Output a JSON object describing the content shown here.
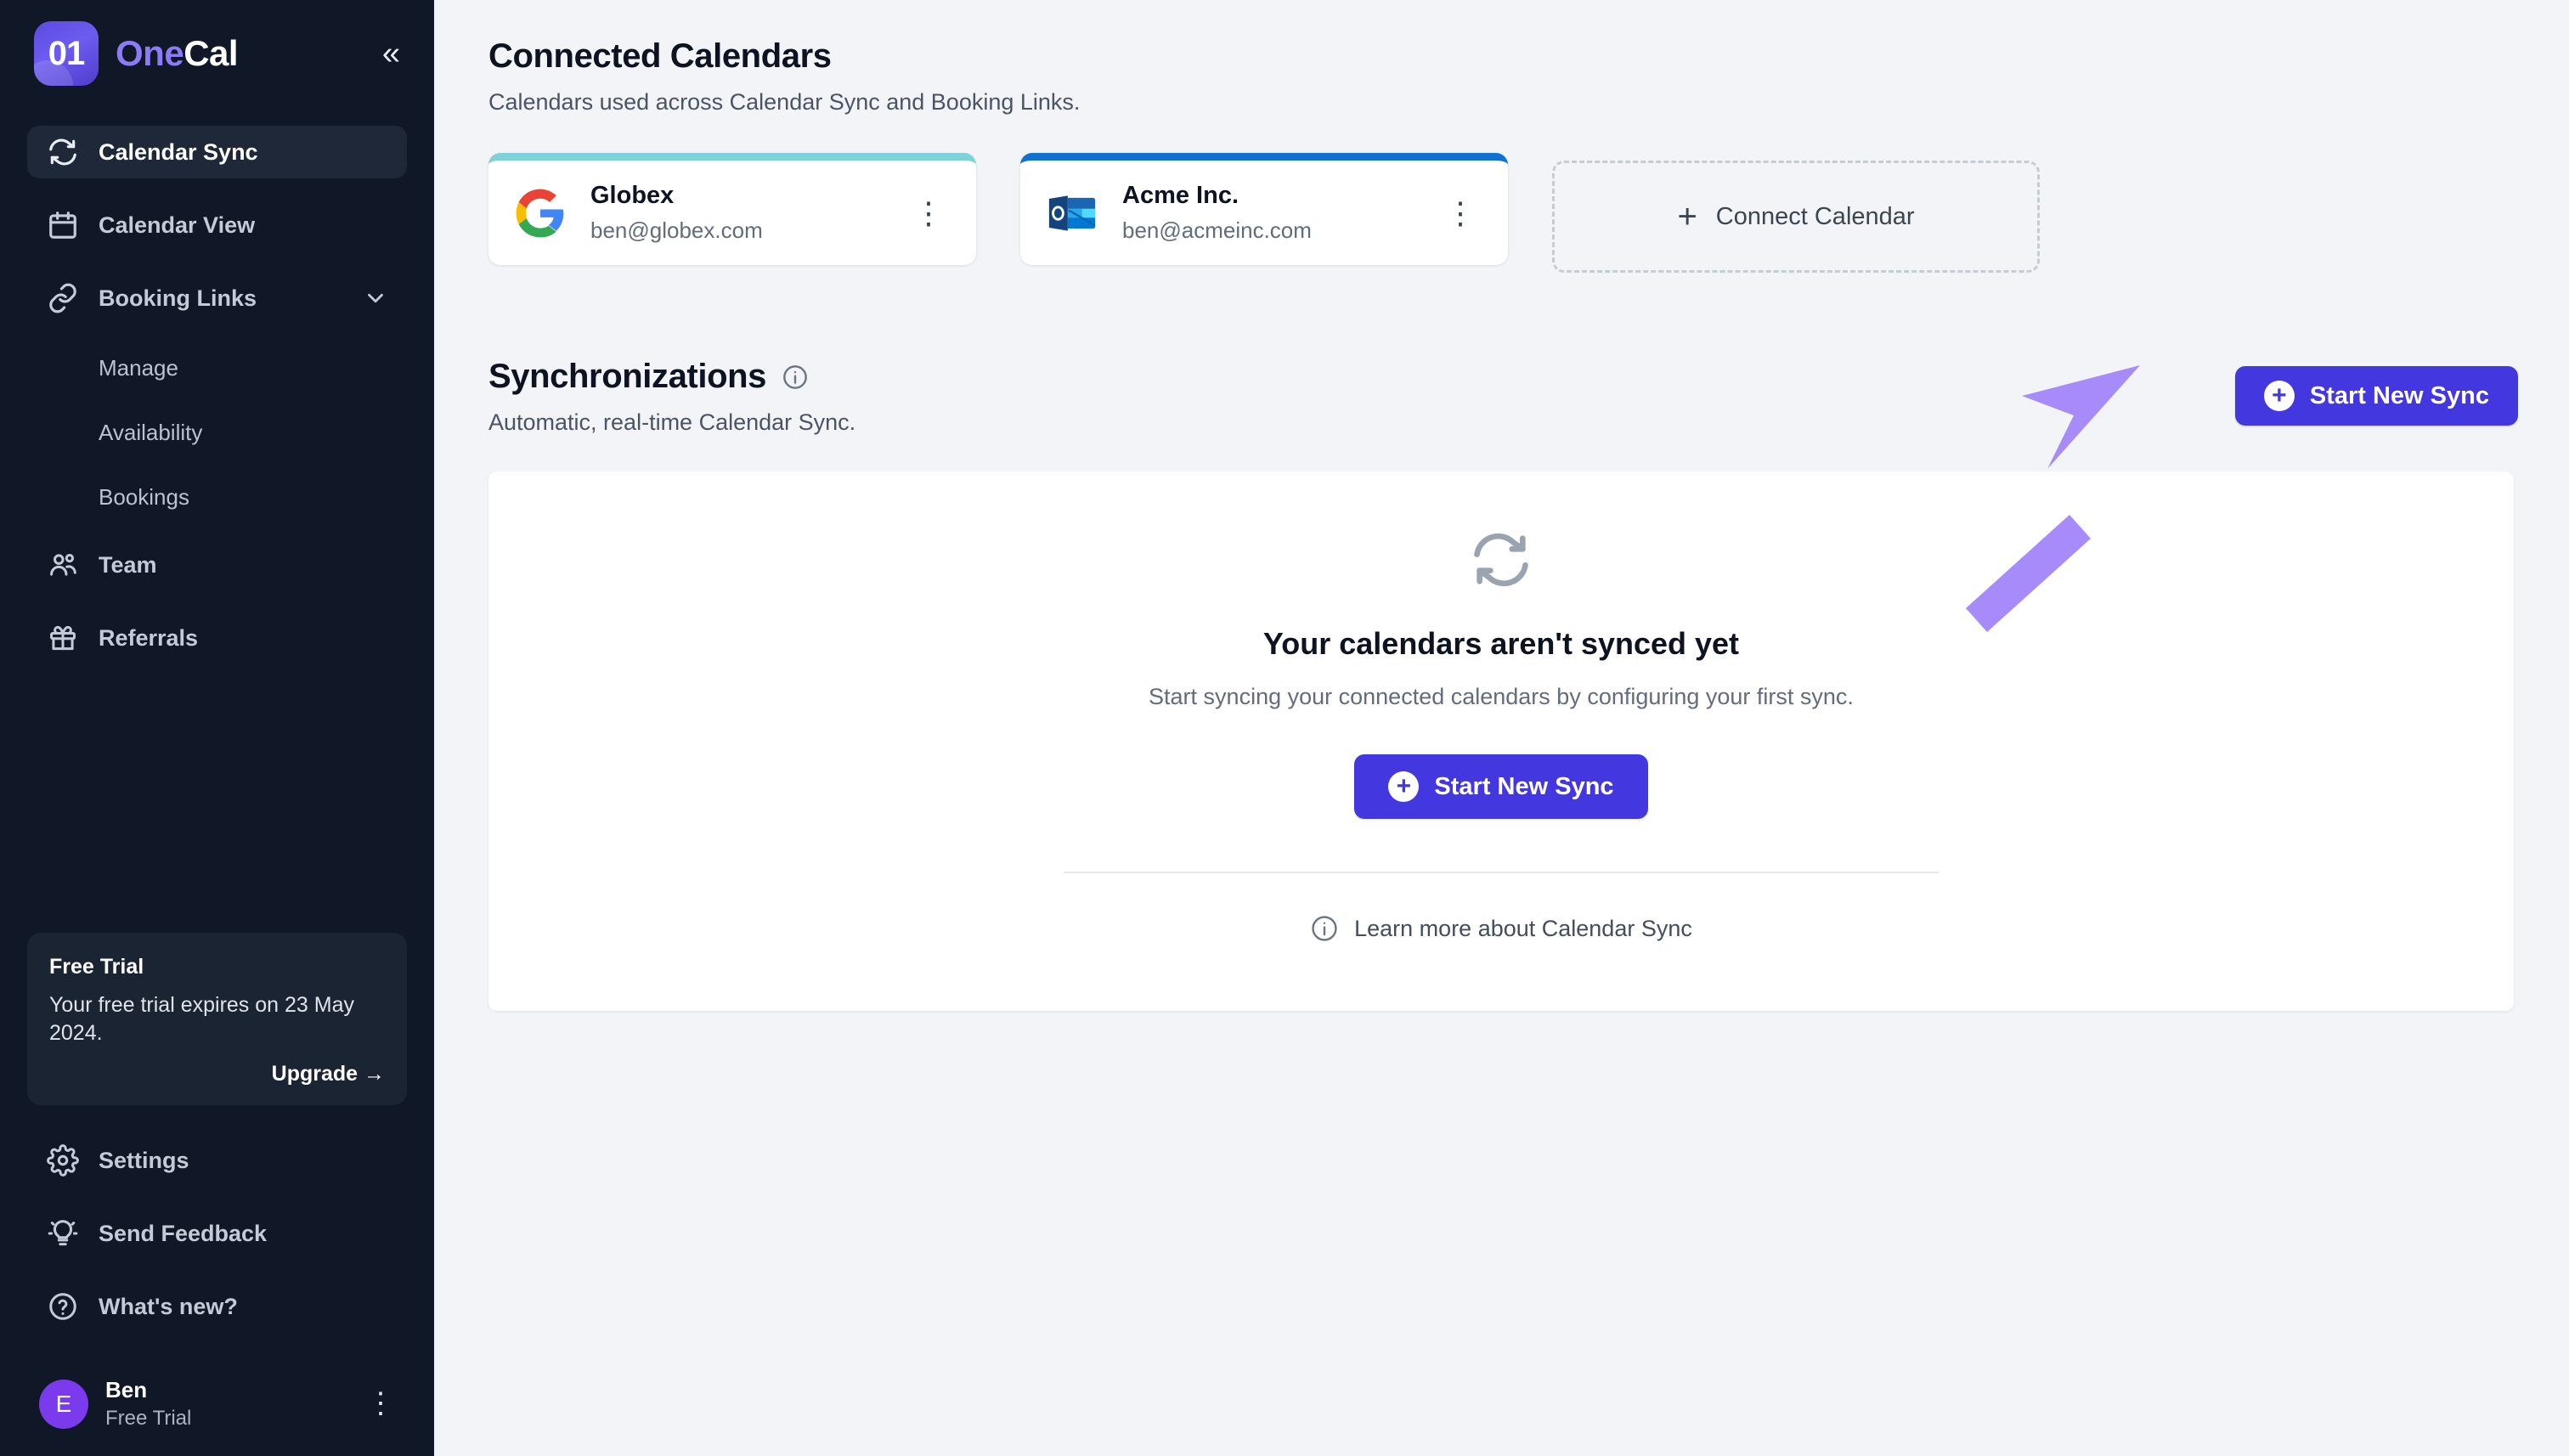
{
  "brand": {
    "logo_text": "01",
    "name_first": "One",
    "name_second": "Cal",
    "collapse_icon": "chevrons-left-icon"
  },
  "sidebar": {
    "nav": [
      {
        "label": "Calendar Sync",
        "icon": "sync-icon",
        "active": true
      },
      {
        "label": "Calendar View",
        "icon": "calendar-icon",
        "active": false
      },
      {
        "label": "Booking Links",
        "icon": "link-icon",
        "active": false,
        "expandable": true
      }
    ],
    "sub_items": [
      {
        "label": "Manage"
      },
      {
        "label": "Availability"
      },
      {
        "label": "Bookings"
      }
    ],
    "nav_lower": [
      {
        "label": "Team",
        "icon": "users-icon"
      },
      {
        "label": "Referrals",
        "icon": "gift-icon"
      }
    ],
    "trial": {
      "title": "Free Trial",
      "text": "Your free trial expires on 23 May 2024.",
      "upgrade_label": "Upgrade →"
    },
    "bottom_nav": [
      {
        "label": "Settings",
        "icon": "gear-icon"
      },
      {
        "label": "Send Feedback",
        "icon": "lightbulb-icon"
      },
      {
        "label": "What's new?",
        "icon": "question-circle-icon"
      }
    ],
    "user": {
      "avatar_initial": "E",
      "name": "Ben",
      "plan": "Free Trial",
      "menu_icon": "kebab-menu-icon"
    }
  },
  "main": {
    "connected": {
      "title": "Connected Calendars",
      "subtitle": "Calendars used across Calendar Sync and Booking Links.",
      "cards": [
        {
          "provider": "google",
          "name": "Globex",
          "email": "ben@globex.com",
          "accent": "#7dd3d8"
        },
        {
          "provider": "outlook",
          "name": "Acme Inc.",
          "email": "ben@acmeinc.com",
          "accent": "#0f72d3"
        }
      ],
      "connect_label": "Connect Calendar"
    },
    "sync": {
      "title": "Synchronizations",
      "subtitle": "Automatic, real-time Calendar Sync.",
      "info_icon": "info-icon",
      "start_button": "Start New Sync"
    },
    "empty_state": {
      "icon": "sync-icon",
      "title": "Your calendars aren't synced yet",
      "subtitle": "Start syncing your connected calendars by configuring your first sync.",
      "button": "Start New Sync",
      "learn_more": "Learn more about Calendar Sync",
      "learn_more_icon": "info-icon"
    },
    "annotation": {
      "type": "arrow",
      "color": "#a78bfa",
      "points_to": "Start New Sync"
    }
  }
}
